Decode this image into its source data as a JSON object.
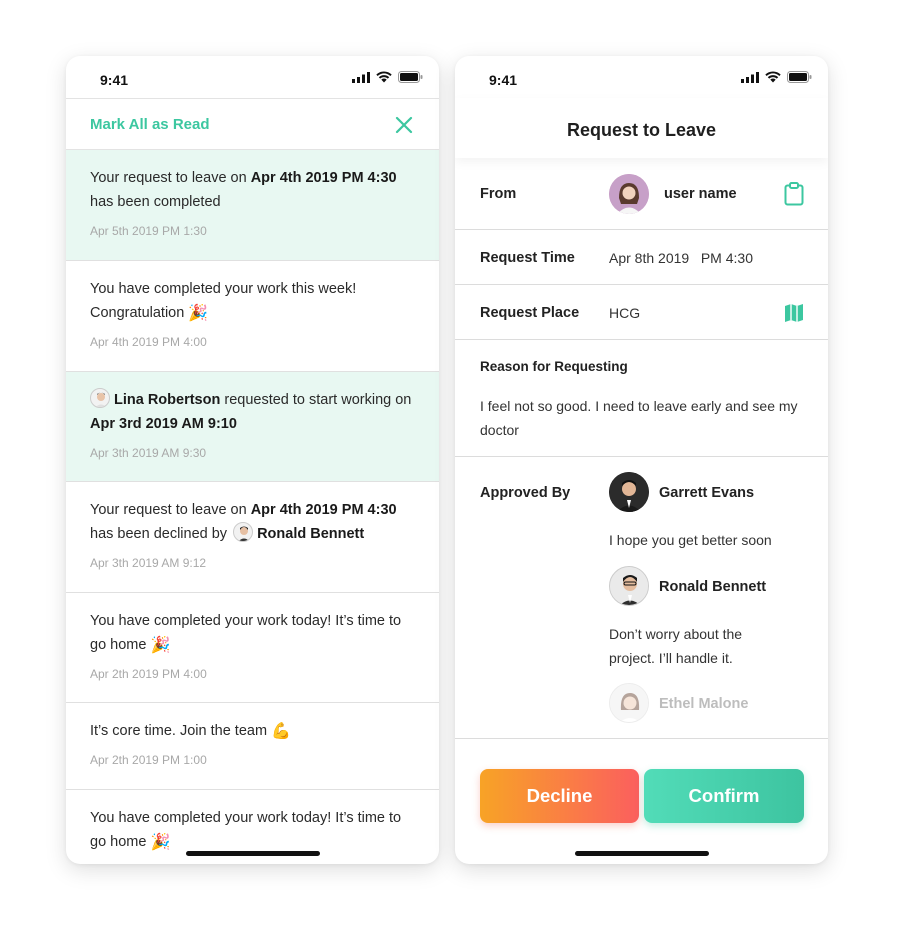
{
  "left": {
    "status_time": "9:41",
    "mark_all_label": "Mark All as Read",
    "notifications": [
      {
        "text": [
          "Your request to leave on ",
          "Apr 4th 2019 PM 4:30",
          " has been completed"
        ],
        "time": "Apr 5th 2019 PM 1:30",
        "unread": true
      },
      {
        "text": [
          "You have completed your work  this week! Congratulation "
        ],
        "time": "Apr 4th 2019 PM 4:00",
        "unread": false,
        "emoji": "🎉"
      },
      {
        "text": [
          "Lina Robertson",
          " requested to start working on ",
          "Apr 3rd 2019 AM 9:10"
        ],
        "time": "Apr 3th 2019 AM 9:30",
        "unread": true
      },
      {
        "text": [
          "Your request to leave on ",
          "Apr 4th 2019 PM 4:30",
          " has been declined by ",
          "Ronald Bennett"
        ],
        "time": "Apr 3th 2019 AM 9:12",
        "unread": false
      },
      {
        "text": [
          "You have completed your work today! It’s time to go home "
        ],
        "time": "Apr 2th 2019 PM 4:00",
        "unread": false,
        "emoji": "🎉"
      },
      {
        "text": [
          "It’s core time. Join the team "
        ],
        "time": "Apr 2th 2019 PM 1:00",
        "unread": false,
        "emoji": "💪"
      },
      {
        "text": [
          "You have completed your work today! It’s time to go home "
        ],
        "time": "",
        "unread": false,
        "emoji": "🎉"
      }
    ]
  },
  "right": {
    "status_time": "9:41",
    "title": "Request to Leave",
    "from_label": "From",
    "from_name": "user name",
    "request_time_label": "Request Time",
    "request_time_value": "Apr 8th 2019   PM 4:30",
    "request_place_label": "Request Place",
    "request_place_value": "HCG",
    "reason_label": "Reason for Requesting",
    "reason_text": "I feel not so good. I need to leave early and see my doctor",
    "approved_label": "Approved By",
    "approvers": [
      {
        "name": "Garrett Evans",
        "comment": "I hope you get better soon"
      },
      {
        "name": "Ronald Bennett",
        "comment": "Don’t worry about the project. I’ll handle it."
      },
      {
        "name": "Ethel Malone",
        "comment": ""
      }
    ],
    "decline_label": "Decline",
    "confirm_label": "Confirm"
  },
  "colors": {
    "accent_green": "#3cc7a0",
    "unread_bg": "#e8f8f2",
    "decline_from": "#f8a326",
    "decline_to": "#fb5f5e"
  },
  "icons": [
    "cellular-signal-icon",
    "wifi-icon",
    "battery-icon",
    "close-icon",
    "clipboard-icon",
    "map-icon",
    "party-popper-icon",
    "flexed-biceps-icon"
  ]
}
